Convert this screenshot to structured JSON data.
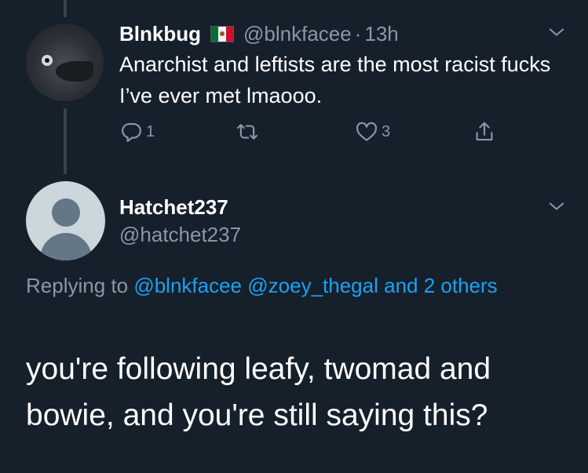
{
  "tweet1": {
    "name": "Blnkbug",
    "handle": "@blnkfacee",
    "separator": "·",
    "time": "13h",
    "text": "Anarchist and leftists are the most racist fucks I’ve ever met lmaooo.",
    "replies": "1",
    "likes": "3"
  },
  "tweet2": {
    "name": "Hatchet237",
    "handle": "@hatchet237",
    "replying_prefix": "Replying to",
    "mention1": "@blnkfacee",
    "mention2": "@zoey_thegal",
    "others": "and 2 others",
    "text": "you're following leafy, twomad and bowie, and you're still saying this?"
  },
  "colors": {
    "background": "#15202b",
    "secondary_text": "#8899a6",
    "link": "#1da1f2",
    "thread_line": "#38444d"
  },
  "icons": [
    "reply-icon",
    "retweet-icon",
    "like-icon",
    "share-icon",
    "chevron-down-icon",
    "mexico-flag-icon"
  ]
}
